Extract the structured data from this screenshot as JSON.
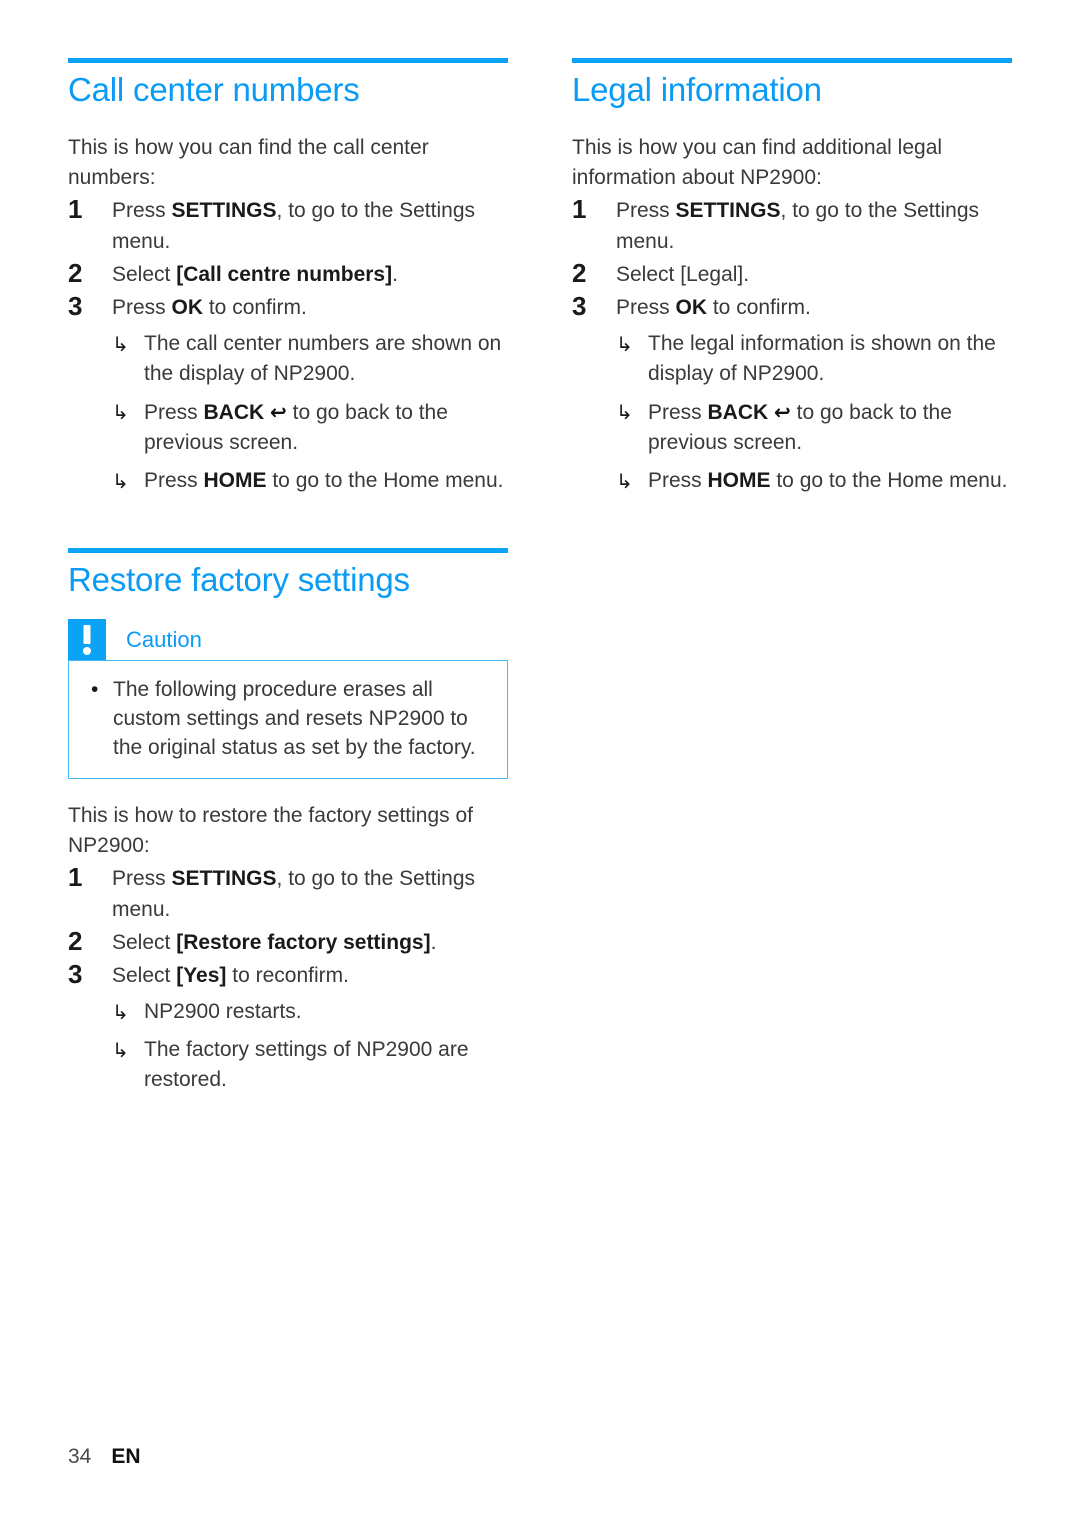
{
  "page": {
    "number": "34",
    "language": "EN"
  },
  "theme": {
    "accent": "#0aa3f5",
    "heading_color": "#0a9bf5",
    "body_color": "#3a3a3a",
    "note_border": "#4ab6f0"
  },
  "icons": {
    "result_arrow": "↳",
    "back_arrow": "↩",
    "bullet": "•"
  },
  "sections": {
    "call_center": {
      "heading": "Call center numbers",
      "intro": "This is how you can find the call center numbers:",
      "steps": [
        {
          "num": "1",
          "parts": [
            {
              "text": "Press ",
              "bold": false
            },
            {
              "text": "SETTINGS",
              "bold": true
            },
            {
              "text": ", to go to the Settings menu.",
              "bold": false
            }
          ]
        },
        {
          "num": "2",
          "parts": [
            {
              "text": "Select ",
              "bold": false
            },
            {
              "text": "[Call centre numbers]",
              "bold": true
            },
            {
              "text": ".",
              "bold": false
            }
          ]
        },
        {
          "num": "3",
          "parts": [
            {
              "text": "Press ",
              "bold": false
            },
            {
              "text": "OK",
              "bold": true
            },
            {
              "text": " to confirm.",
              "bold": false
            }
          ],
          "results": [
            {
              "parts": [
                {
                  "text": "The call center numbers are shown on the display of NP2900.",
                  "bold": false
                }
              ]
            },
            {
              "parts": [
                {
                  "text": "Press ",
                  "bold": false
                },
                {
                  "text": "BACK",
                  "bold": true
                },
                {
                  "text": " ",
                  "bold": false
                },
                {
                  "text": "↩",
                  "icon": "back-arrow-icon"
                },
                {
                  "text": " to go back to the previous screen.",
                  "bold": false
                }
              ]
            },
            {
              "parts": [
                {
                  "text": "Press ",
                  "bold": false
                },
                {
                  "text": "HOME",
                  "bold": true
                },
                {
                  "text": " to go to the Home menu.",
                  "bold": false
                }
              ]
            }
          ]
        }
      ]
    },
    "legal_information": {
      "heading": "Legal information",
      "intro": "This is how you can find additional legal information about NP2900:",
      "steps": [
        {
          "num": "1",
          "parts": [
            {
              "text": "Press ",
              "bold": false
            },
            {
              "text": "SETTINGS",
              "bold": true
            },
            {
              "text": ", to go to the Settings menu.",
              "bold": false
            }
          ]
        },
        {
          "num": "2",
          "parts": [
            {
              "text": "Select [Legal].",
              "bold": false
            }
          ]
        },
        {
          "num": "3",
          "parts": [
            {
              "text": "Press ",
              "bold": false
            },
            {
              "text": "OK",
              "bold": true
            },
            {
              "text": " to confirm.",
              "bold": false
            }
          ],
          "results": [
            {
              "parts": [
                {
                  "text": "The legal information is shown on the display of NP2900.",
                  "bold": false
                }
              ]
            },
            {
              "parts": [
                {
                  "text": "Press ",
                  "bold": false
                },
                {
                  "text": "BACK",
                  "bold": true
                },
                {
                  "text": " ",
                  "bold": false
                },
                {
                  "text": "↩",
                  "icon": "back-arrow-icon"
                },
                {
                  "text": " to go back to the previous screen.",
                  "bold": false
                }
              ]
            },
            {
              "parts": [
                {
                  "text": "Press ",
                  "bold": false
                },
                {
                  "text": "HOME",
                  "bold": true
                },
                {
                  "text": " to go to the Home menu.",
                  "bold": false
                }
              ]
            }
          ]
        }
      ]
    },
    "restore_factory_settings": {
      "heading": "Restore factory settings",
      "note": {
        "title": "Caution",
        "items": [
          "The following procedure erases all custom settings and resets NP2900 to the original status as set by the factory."
        ]
      },
      "intro": "This is how to restore the factory settings of NP2900:",
      "steps": [
        {
          "num": "1",
          "parts": [
            {
              "text": "Press ",
              "bold": false
            },
            {
              "text": "SETTINGS",
              "bold": true
            },
            {
              "text": ", to go to the Settings menu.",
              "bold": false
            }
          ]
        },
        {
          "num": "2",
          "parts": [
            {
              "text": "Select ",
              "bold": false
            },
            {
              "text": "[Restore factory settings]",
              "bold": true
            },
            {
              "text": ".",
              "bold": false
            }
          ]
        },
        {
          "num": "3",
          "parts": [
            {
              "text": "Select ",
              "bold": false
            },
            {
              "text": "[Yes]",
              "bold": true
            },
            {
              "text": " to reconfirm.",
              "bold": false
            }
          ],
          "results": [
            {
              "parts": [
                {
                  "text": "NP2900 restarts.",
                  "bold": false
                }
              ]
            },
            {
              "parts": [
                {
                  "text": "The factory settings of NP2900 are restored.",
                  "bold": false
                }
              ]
            }
          ]
        }
      ]
    }
  }
}
